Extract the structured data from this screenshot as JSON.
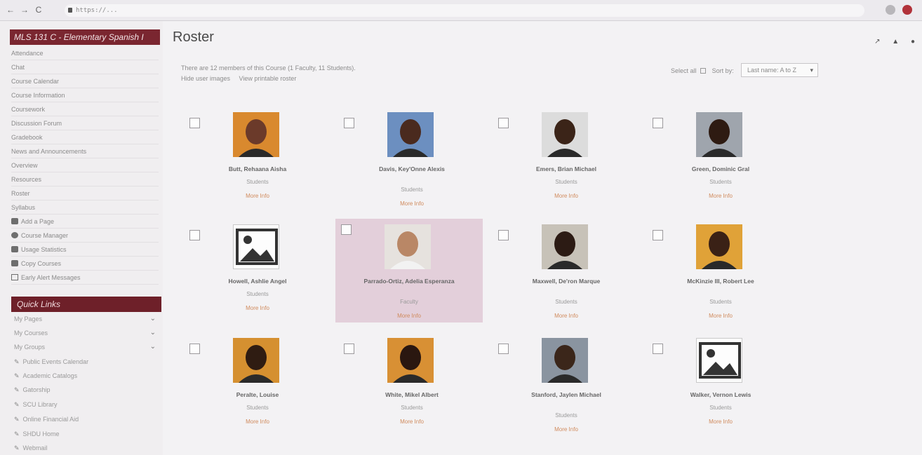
{
  "browser": {
    "url": "https://...",
    "nav": [
      "←",
      "→",
      "C"
    ]
  },
  "sidebar": {
    "course_title": "MLS 131 C - Elementary Spanish I",
    "items": [
      {
        "label": "Attendance"
      },
      {
        "label": "Chat"
      },
      {
        "label": "Course Calendar"
      },
      {
        "label": "Course Information"
      },
      {
        "label": "Coursework"
      },
      {
        "label": "Discussion Forum"
      },
      {
        "label": "Gradebook"
      },
      {
        "label": "News and Announcements"
      },
      {
        "label": "Overview"
      },
      {
        "label": "Resources"
      },
      {
        "label": "Roster"
      },
      {
        "label": "Syllabus"
      },
      {
        "label": "Add a Page"
      },
      {
        "label": "Course Manager"
      },
      {
        "label": "Usage Statistics"
      },
      {
        "label": "Copy Courses"
      },
      {
        "label": "Early Alert Messages"
      }
    ],
    "quick_links_title": "Quick Links",
    "quick_links": [
      {
        "label": "My Pages"
      },
      {
        "label": "My Courses"
      },
      {
        "label": "My Groups"
      },
      {
        "label": "Public Events Calendar"
      },
      {
        "label": "Academic Catalogs"
      },
      {
        "label": "Gatorship"
      },
      {
        "label": "SCU Library"
      },
      {
        "label": "Online Financial Aid"
      },
      {
        "label": "SHDU Home"
      },
      {
        "label": "Webmail"
      }
    ]
  },
  "main": {
    "title": "Roster",
    "summary": "There are 12 members of this Course (1 Faculty, 11 Students).",
    "links": [
      "Hide user images",
      "View printable roster"
    ],
    "select_all_label": "Select all",
    "sort_label": "Sort by:",
    "sort_value": "Last name: A to Z",
    "more_info_label": "More Info",
    "members": [
      {
        "name": "Butt, Rehaana Aisha",
        "role": "Students",
        "photo": "photo"
      },
      {
        "name": "Davis, Key'Onne Alexis",
        "role": "Students",
        "photo": "photo"
      },
      {
        "name": "Emers, Brian Michael",
        "role": "Students",
        "photo": "photo"
      },
      {
        "name": "Green, Dominic Gral",
        "role": "Students",
        "photo": "photo"
      },
      {
        "name": "Howell, Ashlie Angel",
        "role": "Students",
        "photo": "placeholder"
      },
      {
        "name": "Parrado-Ortiz, Adelia Esperanza",
        "role": "Faculty",
        "photo": "photo"
      },
      {
        "name": "Maxwell, De'ron Marque",
        "role": "Students",
        "photo": "photo"
      },
      {
        "name": "McKinzie III, Robert Lee",
        "role": "Students",
        "photo": "photo"
      },
      {
        "name": "Peralte, Louise",
        "role": "Students",
        "photo": "photo"
      },
      {
        "name": "White, Mikel Albert",
        "role": "Students",
        "photo": "photo"
      },
      {
        "name": "Stanford, Jaylen Michael",
        "role": "Students",
        "photo": "photo"
      },
      {
        "name": "Walker, Vernon Lewis",
        "role": "Students",
        "photo": "placeholder"
      }
    ]
  },
  "colors": {
    "brand": "#7a2630",
    "link_orange": "#d08a5c"
  }
}
